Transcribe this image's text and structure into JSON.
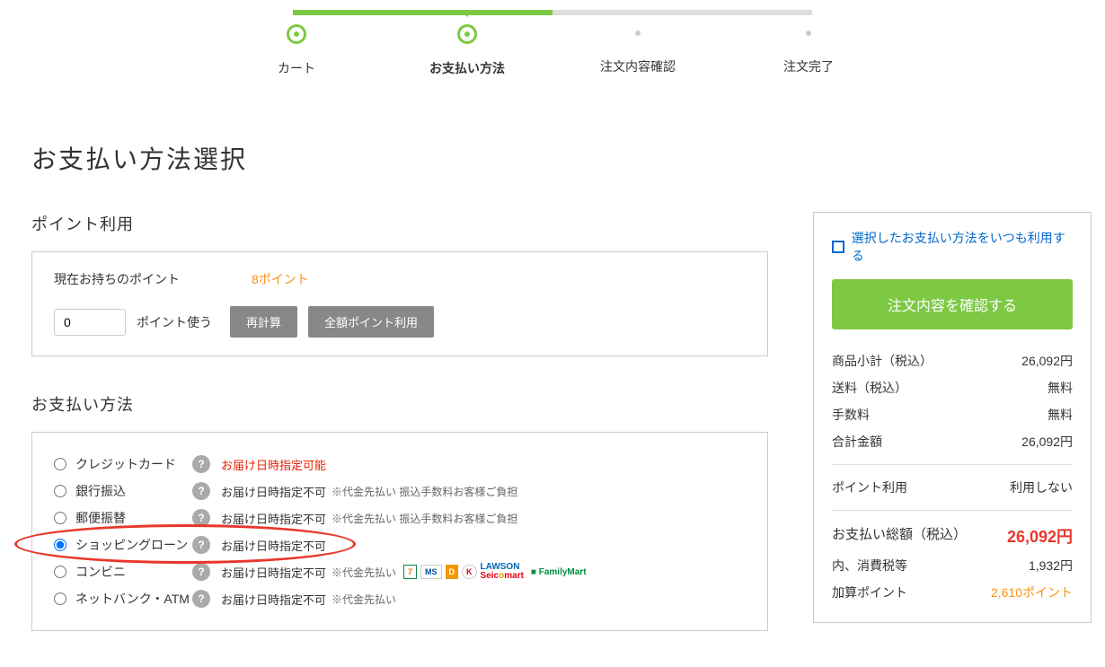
{
  "stepper": [
    {
      "label": "カート",
      "state": "done"
    },
    {
      "label": "お支払い方法",
      "state": "current"
    },
    {
      "label": "注文内容確認",
      "state": "pending"
    },
    {
      "label": "注文完了",
      "state": "pending"
    }
  ],
  "pageTitle": "お支払い方法選択",
  "points": {
    "heading": "ポイント利用",
    "currentLabel": "現在お持ちのポイント",
    "currentValue": "8ポイント",
    "inputValue": "0",
    "useLabel": "ポイント使う",
    "recalcBtn": "再計算",
    "allPointsBtn": "全額ポイント利用"
  },
  "payment": {
    "heading": "お支払い方法",
    "options": [
      {
        "name": "クレジットカード",
        "selected": false,
        "note": "お届け日時指定可能",
        "noteRed": true,
        "sub": ""
      },
      {
        "name": "銀行振込",
        "selected": false,
        "note": "お届け日時指定不可",
        "noteRed": false,
        "sub": "※代金先払い 振込手数料お客様ご負担"
      },
      {
        "name": "郵便振替",
        "selected": false,
        "note": "お届け日時指定不可",
        "noteRed": false,
        "sub": "※代金先払い 振込手数料お客様ご負担"
      },
      {
        "name": "ショッピングローン",
        "selected": true,
        "note": "お届け日時指定不可",
        "noteRed": false,
        "sub": ""
      },
      {
        "name": "コンビニ",
        "selected": false,
        "note": "お届け日時指定不可",
        "noteRed": false,
        "sub": "※代金先払い",
        "logos": [
          "7-11",
          "MINI STOP",
          "Daily",
          "K",
          "LAWSON",
          "Seicomart",
          "FamilyMart"
        ]
      },
      {
        "name": "ネットバンク・ATM",
        "selected": false,
        "note": "お届け日時指定不可",
        "noteRed": false,
        "sub": "※代金先払い"
      }
    ]
  },
  "summary": {
    "rememberLabel": "選択したお支払い方法をいつも利用する",
    "confirmBtn": "注文内容を確認する",
    "rows": [
      {
        "label": "商品小計（税込）",
        "value": "26,092円"
      },
      {
        "label": "送料（税込）",
        "value": "無料"
      },
      {
        "label": "手数料",
        "value": "無料"
      },
      {
        "label": "合計金額",
        "value": "26,092円"
      }
    ],
    "pointUse": {
      "label": "ポイント利用",
      "value": "利用しない"
    },
    "total": {
      "label": "お支払い総額（税込）",
      "value": "26,092円"
    },
    "tax": {
      "label": "内、消費税等",
      "value": "1,932円"
    },
    "addPoint": {
      "label": "加算ポイント",
      "value": "2,610ポイント"
    }
  }
}
